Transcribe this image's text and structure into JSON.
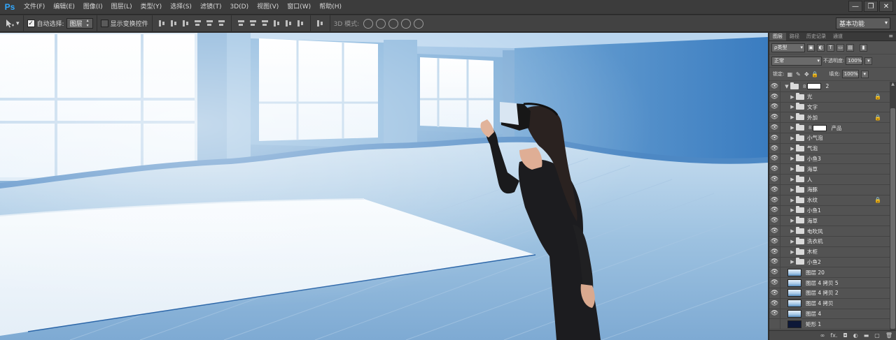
{
  "app": {
    "logo": "Ps"
  },
  "menu": [
    "文件(F)",
    "编辑(E)",
    "图像(I)",
    "图层(L)",
    "类型(Y)",
    "选择(S)",
    "滤镜(T)",
    "3D(D)",
    "视图(V)",
    "窗口(W)",
    "帮助(H)"
  ],
  "window_controls": {
    "minimize": "—",
    "restore": "❐",
    "close": "✕"
  },
  "options": {
    "auto_select_label": "自动选择:",
    "auto_select_value": "图层",
    "show_transform_label": "显示变换控件",
    "mode_3d_label": "3D 模式:",
    "workspace": "基本功能"
  },
  "panel": {
    "tabs": [
      "图层",
      "路径",
      "历史记录",
      "通道"
    ],
    "filter_kind": "ρ类型",
    "blend_mode": "正常",
    "opacity_label": "不透明度:",
    "opacity_value": "100%",
    "lock_label": "锁定:",
    "fill_label": "填充:",
    "fill_value": "100%",
    "footer_icons": [
      "link-icon",
      "fx-icon",
      "mask-icon",
      "adjustment-icon",
      "group-icon",
      "new-layer-icon",
      "trash-icon"
    ],
    "footer_fx": "fx."
  },
  "layers": [
    {
      "name": "2",
      "kind": "group-open",
      "mask": true,
      "visible": true,
      "locked": false,
      "indent": 0
    },
    {
      "name": "光",
      "kind": "group",
      "visible": true,
      "locked": true,
      "indent": 1
    },
    {
      "name": "文字",
      "kind": "group",
      "visible": true,
      "locked": false,
      "indent": 1
    },
    {
      "name": "外加",
      "kind": "group",
      "visible": true,
      "locked": true,
      "indent": 1
    },
    {
      "name": "产品",
      "kind": "group",
      "mask": true,
      "visible": true,
      "locked": false,
      "indent": 1
    },
    {
      "name": "小气泡",
      "kind": "group",
      "visible": true,
      "locked": false,
      "indent": 1
    },
    {
      "name": "气泡",
      "kind": "group",
      "visible": true,
      "locked": false,
      "indent": 1
    },
    {
      "name": "小鱼3",
      "kind": "group",
      "visible": true,
      "locked": false,
      "indent": 1
    },
    {
      "name": "海草",
      "kind": "group",
      "visible": true,
      "locked": false,
      "indent": 1
    },
    {
      "name": "人",
      "kind": "group",
      "visible": true,
      "locked": false,
      "indent": 1
    },
    {
      "name": "海豚",
      "kind": "group",
      "visible": true,
      "locked": false,
      "indent": 1
    },
    {
      "name": "水纹",
      "kind": "group",
      "visible": true,
      "locked": true,
      "indent": 1
    },
    {
      "name": "小鱼1",
      "kind": "group",
      "visible": true,
      "locked": false,
      "indent": 1
    },
    {
      "name": "海草",
      "kind": "group",
      "visible": true,
      "locked": false,
      "indent": 1
    },
    {
      "name": "电吹风",
      "kind": "group",
      "visible": true,
      "locked": false,
      "indent": 1
    },
    {
      "name": "洗衣机",
      "kind": "group",
      "visible": true,
      "locked": false,
      "indent": 1
    },
    {
      "name": "木柜",
      "kind": "group",
      "visible": true,
      "locked": false,
      "indent": 1
    },
    {
      "name": "小鱼2",
      "kind": "group",
      "visible": true,
      "locked": false,
      "indent": 1
    },
    {
      "name": "图层 20",
      "kind": "layer",
      "visible": true,
      "locked": false,
      "indent": 0
    },
    {
      "name": "图层 4 拷贝 5",
      "kind": "layer",
      "visible": true,
      "locked": false,
      "indent": 0
    },
    {
      "name": "图层 4 拷贝 2",
      "kind": "layer",
      "visible": true,
      "locked": false,
      "indent": 0
    },
    {
      "name": "图层 4 拷贝",
      "kind": "layer",
      "visible": true,
      "locked": false,
      "indent": 0
    },
    {
      "name": "图层 4",
      "kind": "layer",
      "visible": true,
      "locked": false,
      "indent": 0
    },
    {
      "name": "矩形 1",
      "kind": "layer-dark",
      "visible": false,
      "locked": false,
      "indent": 0
    }
  ]
}
